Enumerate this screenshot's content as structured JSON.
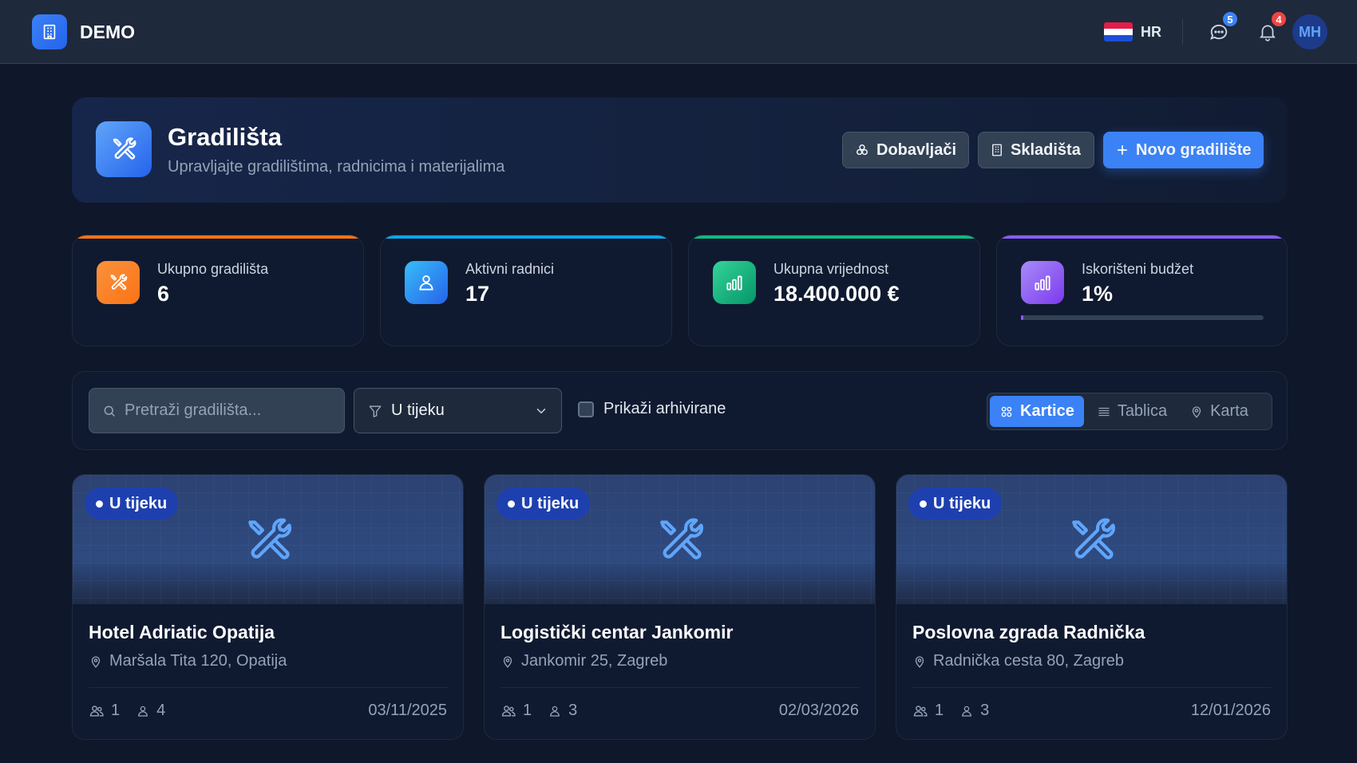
{
  "topbar": {
    "brand": "DEMO",
    "language": "HR",
    "messages_count": "5",
    "notifications_count": "4",
    "avatar_initials": "MH"
  },
  "header": {
    "title": "Gradilišta",
    "subtitle": "Upravljajte gradilištima, radnicima i materijalima",
    "btn_suppliers": "Dobavljači",
    "btn_warehouses": "Skladišta",
    "btn_new_site": "Novo gradilište"
  },
  "stats": [
    {
      "label": "Ukupno gradilišta",
      "value": "6",
      "accent": "#f97316"
    },
    {
      "label": "Aktivni radnici",
      "value": "17",
      "accent": "#0ea5e9"
    },
    {
      "label": "Ukupna vrijednost",
      "value": "18.400.000 €",
      "accent": "#10b981"
    },
    {
      "label": "Iskorišteni budžet",
      "value": "1%",
      "accent": "#8b5cf6",
      "progress_fraction": 0.01
    }
  ],
  "filters": {
    "search_placeholder": "Pretraži gradilišta...",
    "status_selected": "U tijeku",
    "show_archived_label": "Prikaži arhivirane",
    "show_archived_checked": false,
    "views": [
      "Kartice",
      "Tablica",
      "Karta"
    ],
    "active_view": "Kartice"
  },
  "sites": [
    {
      "status": "U tijeku",
      "name": "Hotel Adriatic Opatija",
      "address": "Maršala Tita 120, Opatija",
      "teams": "1",
      "workers": "4",
      "date": "03/11/2025"
    },
    {
      "status": "U tijeku",
      "name": "Logistički centar Jankomir",
      "address": "Jankomir 25, Zagreb",
      "teams": "1",
      "workers": "3",
      "date": "02/03/2026"
    },
    {
      "status": "U tijeku",
      "name": "Poslovna zgrada Radnička",
      "address": "Radnička cesta 80, Zagreb",
      "teams": "1",
      "workers": "3",
      "date": "12/01/2026"
    }
  ],
  "colors": {
    "primary": "#3b82f6",
    "background": "#0f172a",
    "surface": "#1e293b",
    "badge_messages": "#3b82f6",
    "badge_notifications": "#ef4444"
  },
  "icons": {
    "logo": "building-icon",
    "messages": "chat-bubble-icon",
    "notifications": "bell-icon",
    "header": "tools-icon",
    "search": "search-icon",
    "filter": "filter-icon",
    "location": "map-pin-icon"
  }
}
